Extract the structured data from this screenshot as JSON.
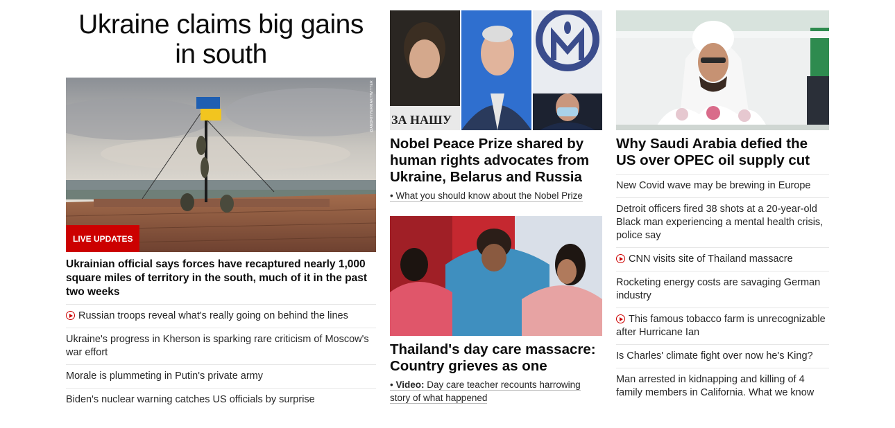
{
  "col1": {
    "title": "Ukraine claims big gains in south",
    "badge": "LIVE UPDATES",
    "photo_credit": "@ANDRIYYERMAK/TWITTER",
    "lead": "Ukrainian official says forces have recaptured nearly 1,000 square miles of territory in the south, much of it in the past two weeks",
    "items": [
      {
        "text": "Russian troops reveal what's really going on behind the lines",
        "video": true
      },
      {
        "text": "Ukraine's progress in Kherson is sparking rare criticism of Moscow's war effort",
        "video": false
      },
      {
        "text": "Morale is plummeting in Putin's private army",
        "video": false
      },
      {
        "text": "Biden's nuclear warning catches US officials by surprise",
        "video": false
      }
    ]
  },
  "col2": {
    "story1": {
      "sign_text": "ЗА НАШУ",
      "headline": "Nobel Peace Prize shared by human rights advocates from Ukraine, Belarus and Russia",
      "sub": "What you should know about the Nobel Prize"
    },
    "story2": {
      "headline": "Thailand's day care massacre: Country grieves as one",
      "sub_prefix": "Video:",
      "sub": "Day care teacher recounts harrowing story of what happened"
    }
  },
  "col3": {
    "headline": "Why Saudi Arabia defied the US over OPEC oil supply cut",
    "items": [
      {
        "text": "New Covid wave may be brewing in Europe",
        "video": false
      },
      {
        "text": "Detroit officers fired 38 shots at a 20-year-old Black man experiencing a mental health crisis, police say",
        "video": false
      },
      {
        "text": "CNN visits site of Thailand massacre",
        "video": true
      },
      {
        "text": "Rocketing energy costs are savaging German industry",
        "video": false
      },
      {
        "text": "This famous tobacco farm is unrecognizable after Hurricane Ian",
        "video": true
      },
      {
        "text": "Is Charles' climate fight over now he's King?",
        "video": false
      },
      {
        "text": "Man arrested in kidnapping and killing of 4 family members in California. What we know",
        "video": false
      }
    ]
  },
  "colors": {
    "accent": "#cc0000",
    "divider": "#e6e6e6",
    "text": "#0c0c0c"
  }
}
